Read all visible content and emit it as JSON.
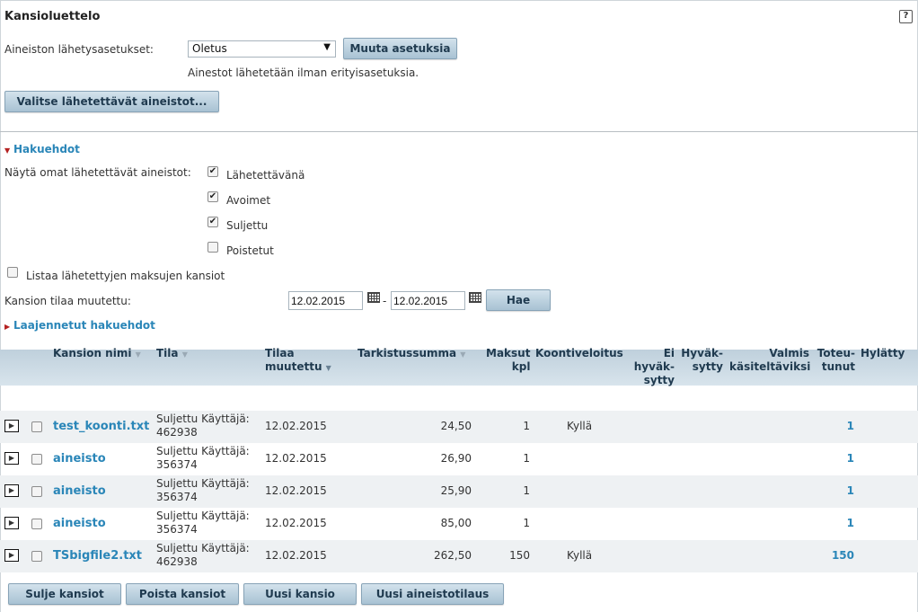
{
  "page": {
    "title": "Kansioluettelo"
  },
  "send_settings": {
    "label": "Aineiston lähetysasetukset:",
    "selected": "Oletus",
    "change_button": "Muuta asetuksia",
    "info": "Ainestot lähetetään ilman erityisasetuksia."
  },
  "select_button": "Valitse lähetettävät aineistot...",
  "search": {
    "toggle_label": "Hakuehdot",
    "show_own_label": "Näytä omat lähetettävät aineistot:",
    "statuses": [
      {
        "label": "Lähetettävänä",
        "checked": true
      },
      {
        "label": "Avoimet",
        "checked": true
      },
      {
        "label": "Suljettu",
        "checked": true
      },
      {
        "label": "Poistetut",
        "checked": false
      }
    ],
    "list_paid_label": "Listaa lähetettyjen maksujen kansiot",
    "changed_label": "Kansion tilaa muutettu:",
    "date_from": "12.02.2015",
    "date_to": "12.02.2015",
    "date_sep": "-",
    "search_button": "Hae",
    "extended_label": "Laajennetut hakuehdot"
  },
  "table": {
    "headers": {
      "name": "Kansion nimi",
      "status": "Tila",
      "changed_1": "Tilaa",
      "changed_2": "muutettu",
      "checksum": "Tarkistussumma",
      "payments_1": "Maksut",
      "payments_2": "kpl",
      "consolidated": "Koontiveloitus",
      "not_approved_1": "Ei",
      "not_approved_2": "hyväk-",
      "not_approved_3": "sytty",
      "approved_1": "Hyväk-",
      "approved_2": "sytty",
      "ready_1": "Valmis",
      "ready_2": "käsiteltäviksi",
      "done_1": "Toteu-",
      "done_2": "tunut",
      "rejected": "Hylätty"
    },
    "rows": [
      {
        "name": "test_koonti.txt",
        "status1": "Suljettu Käyttäjä:",
        "status2": "462938",
        "changed": "12.02.2015",
        "checksum": "24,50",
        "payments": "1",
        "consolidated": "Kyllä",
        "done": "1"
      },
      {
        "name": "aineisto",
        "status1": "Suljettu Käyttäjä:",
        "status2": "356374",
        "changed": "12.02.2015",
        "checksum": "26,90",
        "payments": "1",
        "consolidated": "",
        "done": "1"
      },
      {
        "name": "aineisto",
        "status1": "Suljettu Käyttäjä:",
        "status2": "356374",
        "changed": "12.02.2015",
        "checksum": "25,90",
        "payments": "1",
        "consolidated": "",
        "done": "1"
      },
      {
        "name": "aineisto",
        "status1": "Suljettu Käyttäjä:",
        "status2": "356374",
        "changed": "12.02.2015",
        "checksum": "85,00",
        "payments": "1",
        "consolidated": "",
        "done": "1"
      },
      {
        "name": "TSbigfile2.txt",
        "status1": "Suljettu Käyttäjä:",
        "status2": "462938",
        "changed": "12.02.2015",
        "checksum": "262,50",
        "payments": "150",
        "consolidated": "Kyllä",
        "done": "150"
      }
    ]
  },
  "footer_buttons": {
    "close": "Sulje kansiot",
    "delete": "Poista kansiot",
    "new_folder": "Uusi kansio",
    "new_order": "Uusi aineistotilaus"
  },
  "colors": {
    "link": "#2a86b8",
    "header_bg": "#c9d8e3",
    "button_bg": "#b9cfdd",
    "accent_triangle": "#b42020"
  }
}
